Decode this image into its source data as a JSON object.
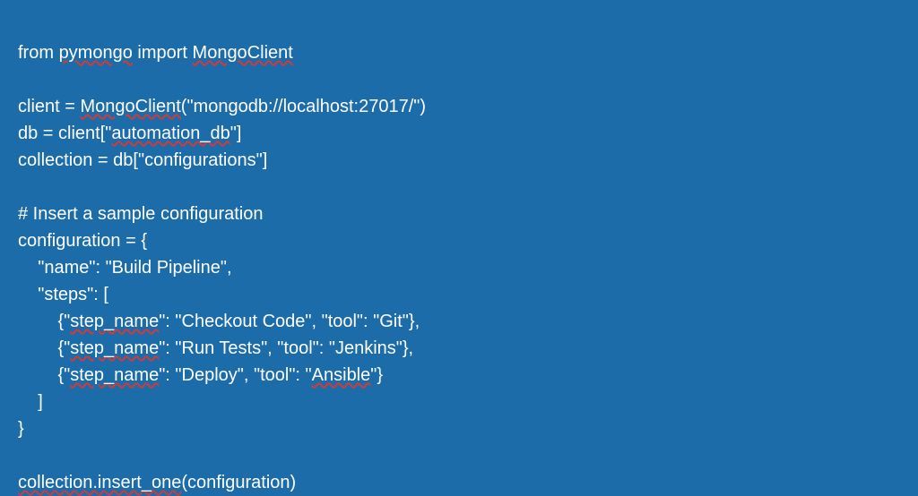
{
  "code": {
    "l1_a": "from ",
    "l1_b": "pymongo",
    "l1_c": " import ",
    "l1_d": "MongoClient",
    "blank1": "",
    "l2_a": "client = ",
    "l2_b": "MongoClient",
    "l2_c": "(\"mongodb://localhost:27017/\")",
    "l3_a": "db = client[\"",
    "l3_b": "automation_db",
    "l3_c": "\"]",
    "l4": "collection = db[\"configurations\"]",
    "blank2": "",
    "l5": "# Insert a sample configuration",
    "l6": "configuration = {",
    "l7": "    \"name\": \"Build Pipeline\",",
    "l8": "    \"steps\": [",
    "l9_a": "        {\"",
    "l9_b": "step_name",
    "l9_c": "\": \"Checkout Code\", \"tool\": \"Git\"},",
    "l10_a": "        {\"",
    "l10_b": "step_name",
    "l10_c": "\": \"Run Tests\", \"tool\": \"Jenkins\"},",
    "l11_a": "        {\"",
    "l11_b": "step_name",
    "l11_c": "\": \"Deploy\", \"tool\": \"",
    "l11_d": "Ansible",
    "l11_e": "\"}",
    "l12": "    ]",
    "l13": "}",
    "blank3": "",
    "l14_a": "collection.insert_one",
    "l14_b": "(configuration)"
  }
}
